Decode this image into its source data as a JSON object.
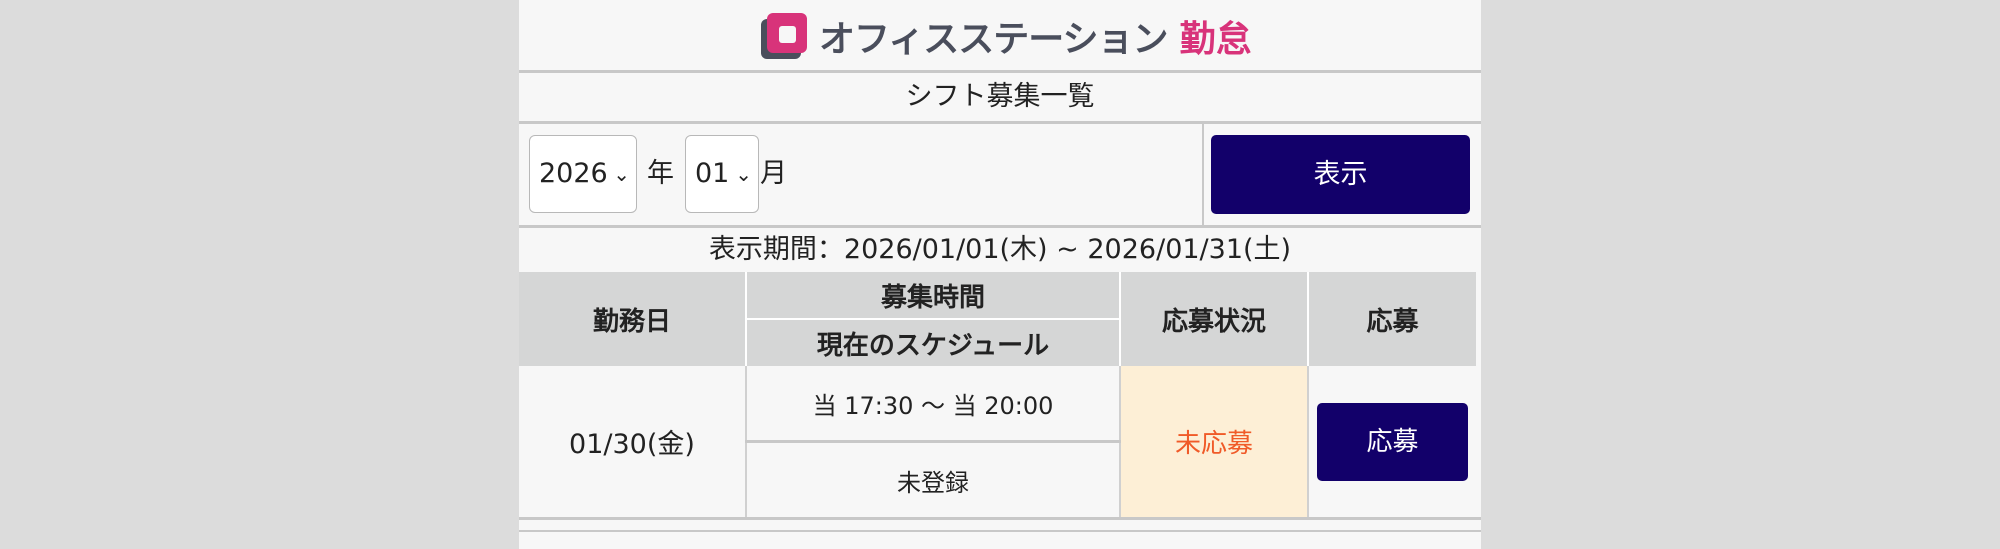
{
  "header": {
    "logo_text": "オフィスステーション",
    "logo_accent": "勤怠",
    "logo_icon": "office-station-logo"
  },
  "page_title": "シフト募集一覧",
  "filter": {
    "year": "2026",
    "year_unit": "年",
    "month": "01",
    "month_unit": "月",
    "show_button": "表示"
  },
  "period": "表示期間：2026/01/01(木) ~ 2026/01/31(土)",
  "table": {
    "headers": {
      "work_date": "勤務日",
      "recruit_time": "募集時間",
      "current_schedule": "現在のスケジュール",
      "status": "応募状況",
      "apply": "応募"
    },
    "rows": [
      {
        "date": "01/30(金)",
        "time": "当 17:30 〜 当 20:00",
        "schedule": "未登録",
        "status": "未応募",
        "apply_label": "応募"
      }
    ]
  },
  "colors": {
    "accent_navy": "#12006a",
    "brand_pink": "#d8337a",
    "status_orange": "#f05a28",
    "status_bg": "#fdefd6"
  }
}
